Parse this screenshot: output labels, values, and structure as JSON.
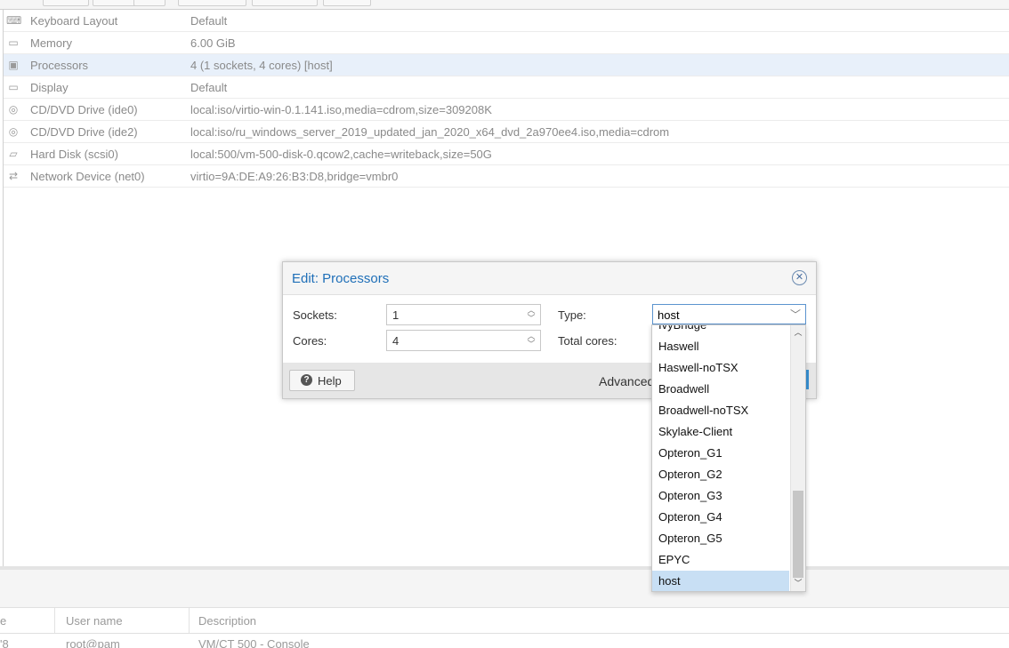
{
  "hardware": [
    {
      "icon": "keyboard-icon",
      "glyph": "⌨",
      "name": "Keyboard Layout",
      "value": "Default"
    },
    {
      "icon": "memory-icon",
      "glyph": "▭",
      "name": "Memory",
      "value": "6.00 GiB"
    },
    {
      "icon": "processor-icon",
      "glyph": "▣",
      "name": "Processors",
      "value": "4 (1 sockets, 4 cores) [host]"
    },
    {
      "icon": "display-icon",
      "glyph": "▭",
      "name": "Display",
      "value": "Default"
    },
    {
      "icon": "cdrom-icon",
      "glyph": "◎",
      "name": "CD/DVD Drive (ide0)",
      "value": "local:iso/virtio-win-0.1.141.iso,media=cdrom,size=309208K"
    },
    {
      "icon": "cdrom-icon",
      "glyph": "◎",
      "name": "CD/DVD Drive (ide2)",
      "value": "local:iso/ru_windows_server_2019_updated_jan_2020_x64_dvd_2a970ee4.iso,media=cdrom"
    },
    {
      "icon": "hard-disk-icon",
      "glyph": "▱",
      "name": "Hard Disk (scsi0)",
      "value": "local:500/vm-500-disk-0.qcow2,cache=writeback,size=50G"
    },
    {
      "icon": "network-icon",
      "glyph": "⇄",
      "name": "Network Device (net0)",
      "value": "virtio=9A:DE:A9:26:B3:D8,bridge=vmbr0"
    }
  ],
  "bottom": {
    "col_partial": "e",
    "col_user": "User name",
    "col_desc": "Description",
    "row_id": "'8",
    "row_user": "root@pam",
    "row_desc": "VM/CT 500 - Console"
  },
  "dialog": {
    "title": "Edit: Processors",
    "close_glyph": "✕",
    "sockets_label": "Sockets:",
    "sockets_value": "1",
    "cores_label": "Cores:",
    "cores_value": "4",
    "type_label": "Type:",
    "type_value": "host",
    "total_cores_label": "Total cores:",
    "help_label": "Help",
    "advanced_label": "Advanced"
  },
  "cpu_types": [
    "IvyBridge",
    "Haswell",
    "Haswell-noTSX",
    "Broadwell",
    "Broadwell-noTSX",
    "Skylake-Client",
    "Opteron_G1",
    "Opteron_G2",
    "Opteron_G3",
    "Opteron_G4",
    "Opteron_G5",
    "EPYC",
    "host"
  ],
  "selected_cpu_type": "host"
}
